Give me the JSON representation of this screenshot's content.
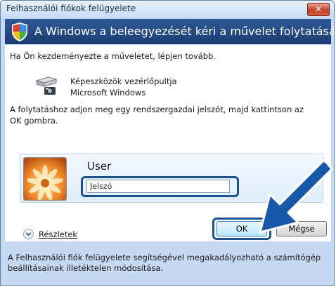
{
  "window": {
    "title": "Felhasználói fiókok felügyelete",
    "close_label": "✕"
  },
  "banner": {
    "text": "A Windows a beleegyezését kéri a művelet folytatásához"
  },
  "content": {
    "intro": "Ha Ön kezdeményezte a műveletet, lépjen tovább.",
    "program_name": "Képeszközök vezérlőpultja",
    "program_publisher": "Microsoft Windows",
    "instruction": "A folytatáshoz adjon meg egy rendszergazdai jelszót, majd kattintson az OK gombra."
  },
  "credentials": {
    "username": "User",
    "password_placeholder": "Jelszó"
  },
  "details": {
    "label": "Részletek"
  },
  "buttons": {
    "ok": "OK",
    "cancel": "Mégse"
  },
  "footer": {
    "text": "A Felhasználói fiók felügyelete segítségével megakadályozható a számítógép beállításainak illetéktelen módosítása."
  },
  "colors": {
    "banner": "#1c3d73",
    "highlight": "#1c5192",
    "arrow": "#1759a8"
  }
}
